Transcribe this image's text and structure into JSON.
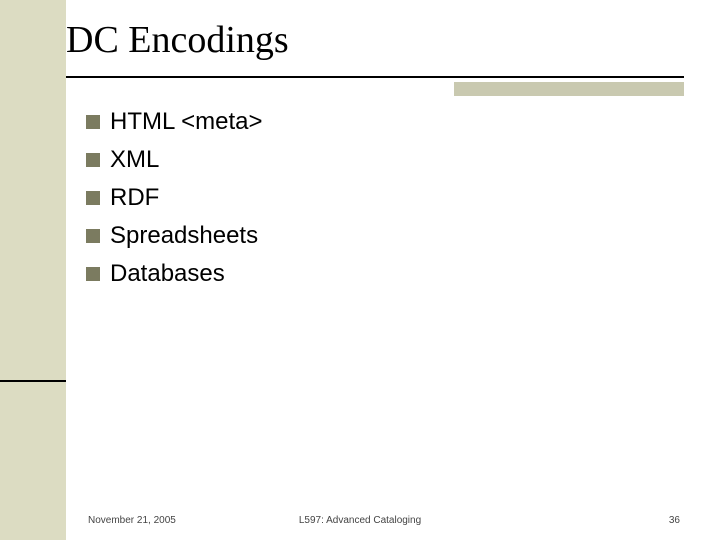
{
  "title": "DC Encodings",
  "bullets": [
    "HTML <meta>",
    "XML",
    "RDF",
    "Spreadsheets",
    "Databases"
  ],
  "footer": {
    "date": "November 21, 2005",
    "course": "L597: Advanced Cataloging",
    "page": "36"
  }
}
